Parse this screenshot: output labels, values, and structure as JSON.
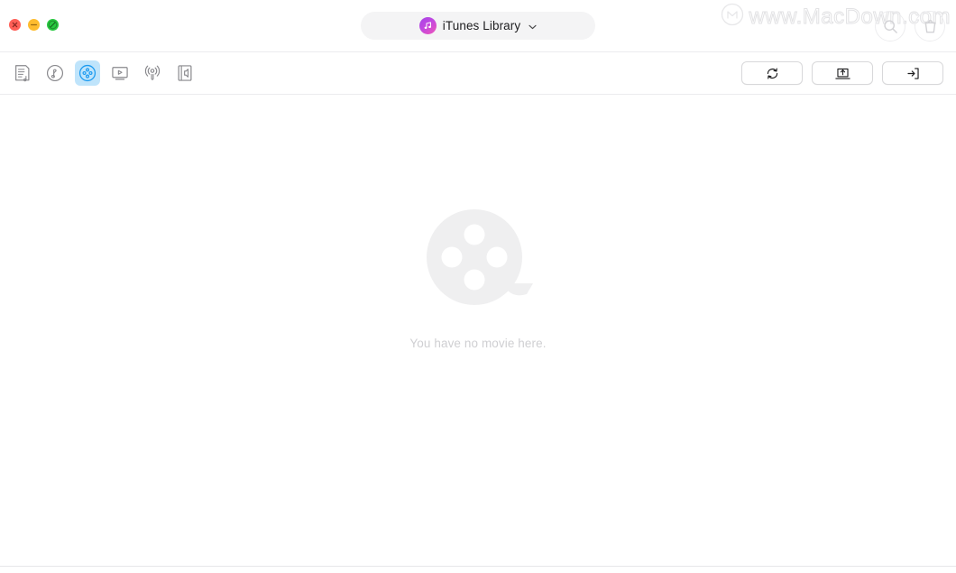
{
  "window": {
    "traffic_lights": [
      {
        "name": "close",
        "color": "#ff5f57"
      },
      {
        "name": "minimize",
        "color": "#febc2e"
      },
      {
        "name": "maximize",
        "color": "#28c840"
      }
    ]
  },
  "titlebar": {
    "library_label": "iTunes Library",
    "library_chevron": "⌄",
    "library_icon": "itunes-music-note-icon",
    "actions": [
      {
        "name": "search",
        "icon": "search-icon"
      },
      {
        "name": "delete",
        "icon": "trash-icon"
      }
    ]
  },
  "watermark": {
    "text": "www.MacDown.com",
    "logo": "macdown-circle-m-logo"
  },
  "toolbar": {
    "categories": [
      {
        "name": "playlists",
        "icon": "playlist-document-icon",
        "label": "Playlists",
        "selected": false
      },
      {
        "name": "music",
        "icon": "music-note-circle-icon",
        "label": "Music",
        "selected": false
      },
      {
        "name": "movies",
        "icon": "film-reel-icon",
        "label": "Movies",
        "selected": true
      },
      {
        "name": "tv-shows",
        "icon": "tv-monitor-icon",
        "label": "TV Shows",
        "selected": false
      },
      {
        "name": "podcasts",
        "icon": "podcast-broadcast-icon",
        "label": "Podcasts",
        "selected": false
      },
      {
        "name": "audiobooks",
        "icon": "audiobook-speaker-icon",
        "label": "Audiobooks",
        "selected": false
      }
    ],
    "actions": [
      {
        "name": "refresh",
        "icon": "refresh-sync-icon",
        "label": "Refresh"
      },
      {
        "name": "import",
        "icon": "laptop-import-icon",
        "label": "Import to device"
      },
      {
        "name": "export",
        "icon": "export-arrow-icon",
        "label": "Export to Mac"
      }
    ],
    "accent_color": "#bfe4fb",
    "accent_icon_color": "#1d9bf0"
  },
  "content": {
    "empty_state": {
      "icon": "film-reel-illustration",
      "message": "You have no movie here."
    }
  }
}
